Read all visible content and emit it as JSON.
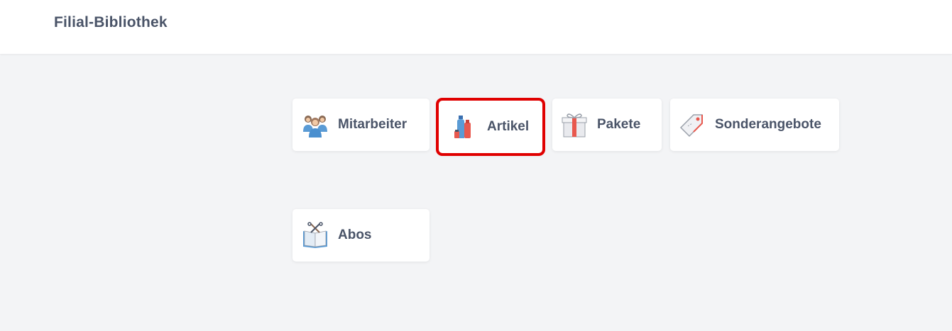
{
  "header": {
    "title": "Filial-Bibliothek"
  },
  "tiles": [
    {
      "label": "Mitarbeiter",
      "icon": "staff-group-icon"
    },
    {
      "label": "Artikel",
      "icon": "products-icon",
      "highlighted": true
    },
    {
      "label": "Pakete",
      "icon": "gift-package-icon"
    },
    {
      "label": "Sonderangebote",
      "icon": "price-tag-icon"
    },
    {
      "label": "Abos",
      "icon": "subscription-book-icon"
    }
  ],
  "colors": {
    "background": "#f3f4f6",
    "header_bg": "#ffffff",
    "text": "#4a5468",
    "highlight": "#e00000"
  }
}
